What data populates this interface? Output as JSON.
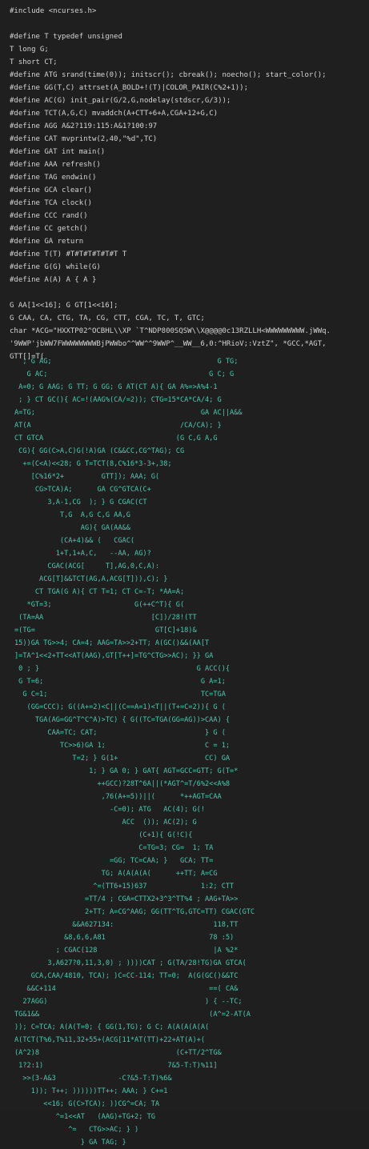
{
  "code": {
    "lines": [
      "#include <ncurses.h>",
      "",
      "#define T typedef unsigned",
      "T long G;",
      "T short CT;",
      "#define ATG srand(time(0)); initscr(); cbreak(); noecho(); start_color();",
      "#define GG(T,C) attrset(A_BOLD+!(T)|COLOR_PAIR(C%2+1));",
      "#define AC(G) init_pair(G/2,G,nodelay(stdscr,G/3));",
      "#define TCT(A,G,C) mvaddch(A+CTT+6+A,CGA+12+G,C)",
      "#define AGG A&2?119:115:A&1?100:97",
      "#define CAT mvprintw(2,40,\"%d\",TC)",
      "#define GAT int main()",
      "#define AAA refresh()",
      "#define TAG endwin()",
      "#define GCA clear()",
      "#define TCA clock()",
      "#define CCC rand()",
      "#define CC getch()",
      "#define GA return",
      "#define T(T) #T#T#T#T#T#T T",
      "#define G(G) while(G)",
      "#define A(A) A { A }",
      "",
      "G AA[1<<16]; G GT[1<<16];",
      "G CAA, CA, CTG, TA, CG, CTT, CGA, TC, T, GTC;",
      "char *ACG=\"HXXTP02^OCBHL\\\\XP `T^NDP800SQSW\\\\X@@@@0c13RZLLH<WWWWWWWWW.jWWq.",
      "'9WWP'jbWW7FWWWWWWWWBjPWWbo^^WW^^9WWP^__WW__6,0:^HRioV;:VztZ\", *GCC,*AGT,",
      "GTT[]=T("
    ],
    "art": [
      "  ; G AG;                                        G TG;",
      "   G AC;                                       G C; G",
      " A=0; G AAG; G TT; G GG; G AT(CT A){ GA A%=>A%4-1",
      " ; } CT GC(){ AC=!(AAG%(CA/=2)); CTG=15*CA*CA/4; G",
      "A=TG;                                        GA AC||A&&",
      "AT(A                                    /CA/CA); }",
      "CT GTCA                                (G C,G A,G",
      " CG){ GG(C>A,C)G(!A)GA (C&&CC,CG^TAG); CG",
      "  +=(C<A)<<28; G T=TCT(8,C%16*3-3+,38;",
      "    [C%16*2+         GTT]); AAA; G(",
      "     CG>TCA)A;      GA CG^GTCA(C+",
      "        3,A-1,CG  ); } G CGAC(CT",
      "           T,G  A,G C,G AA,G",
      "                AG){ GA(AA&&",
      "           (CA+4)&& (   CGAC(",
      "          1+T,1+A,C,   --AA, AG)?",
      "        CGAC(ACG[     T],AG,0,C,A):",
      "      ACG[T]&&TCT(AG,A,ACG[T])),C); }",
      "     CT TGA(G A){ CT T=1; CT C=-T; *AA=A;",
      "   *GT=3;                    G(++C^T){ G(",
      " (TA=AA                          [C])/28!(TT",
      "=(TG=                             GT[C]+18)&",
      "15))GA TG>>4; CA=4; AAG=TA>>2+TT; A(GC()&&(AA[T",
      "]=TA^1<<2+TT<<AT(AAG),GT[T++]=TG^CTG>>AC); }} GA",
      " 0 ; }                                      G ACC(){",
      " G T=6;                                      G A=1;",
      "  G C=1;                                     TC=TGA",
      "   (GG=CCC); G((A+=2)<C||(C==A=1)<T||(T+=C=2)){ G (",
      "     TGA(AG=GG^T^C^A)>TC) { G((TC=TGA(GG=AG))>CAA) {",
      "        CAA=TC; CAT;                          } G (",
      "           TC>>6)GA 1;                        C = 1;",
      "              T=2; } G(1+                     CC) GA",
      "                  1; } GA 0; } GAT{ AGT=GCC=GTT; G(T=*",
      "                    ++GCC)?28T^6A||(*AGT^=T/6%2<<A%8",
      "                     ,76(A+=5))||(      *++AGT=CAA",
      "                       -C=0); ATG   AC(4); G(!",
      "                          ACC  ()); AC(2); G",
      "                              (C+1){ G(!C){",
      "                              C=TG=3; CG=  1; TA",
      "                       =GG; TC=CAA; }   GCA; TT=",
      "                     TG; A(A(A(A(      ++TT; A=CG",
      "                   ^=(TT6+15)637             1:2; CTT",
      "                 =TT/4 ; CGA=CTTX2+3^3^TT%4 ; AAG+TA>>",
      "                 2+TT; A=CG^AAG; GG(TT^TG,GTC=TT) CGAC(GTC",
      "              &&A627134:                        118,TT",
      "            &8,6,6,A81                         78 :5)",
      "          ; CGAC(128                            |A %2*",
      "        3,A627?0,11,3,0) ; ))))CAT ; G(TA/28!TG)GA GTCA(",
      "    GCA,CAA/4810, TCA); )C=CC-114; TT=0;  A(G(GC()&&TC",
      "   &&C+114                                     ==( CA&",
      "  27AGG)                                      ) { --TC;",
      "TG&1&&                                         (A^=2-AT(A",
      ")); C=TCA; A(A(T=0; { GG(1,TG); G C; A(A(A(A(A(",
      "A(TCT(T%6,T%11,32+55+(ACG[11*AT(TT)+22+AT(A)+(",
      "(A^2)8                                 (C+TT/2^TG&",
      " 1?2:1)                              7&5-T:T)%11]",
      "  >>(3-A&3               -C?&5-T:T)%6&",
      "    1)); T++; ))))))TT++; AAA; } C+=1",
      "       <<16; G(C>TCA); ))CG^=CA; TA",
      "          ^=1<<AT   (AAG)+TG+2; TG",
      "             ^=   CTG>>AC; } )",
      "                } GA TAG; }"
    ]
  }
}
